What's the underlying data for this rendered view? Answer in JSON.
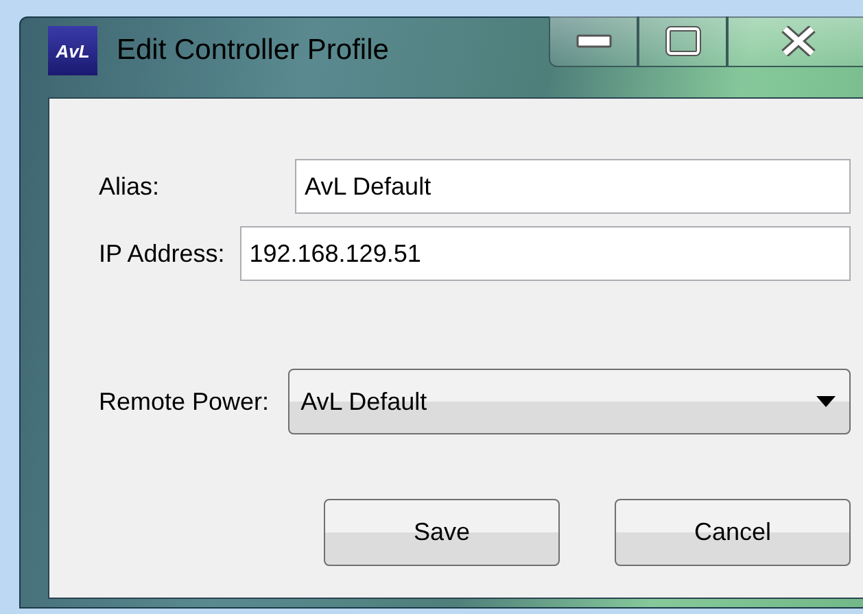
{
  "window": {
    "title": "Edit Controller Profile",
    "icon_text": "AvL"
  },
  "fields": [
    {
      "label": "Alias:",
      "value": "AvL Default",
      "kind": "text"
    },
    {
      "label": "IP Address:",
      "value": "192.168.129.51",
      "kind": "text"
    },
    {
      "label": "Remote Power:",
      "value": "AvL Default",
      "kind": "dropdown"
    }
  ],
  "buttons": [
    "Save",
    "Cancel"
  ]
}
